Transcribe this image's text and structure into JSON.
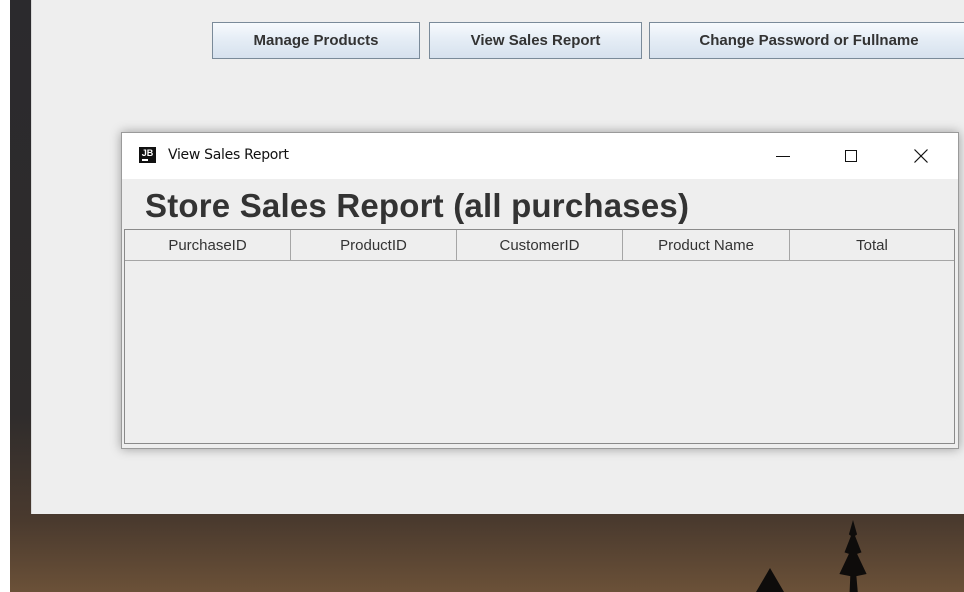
{
  "toolbar": {
    "manage_products_label": "Manage Products",
    "view_sales_report_label": "View Sales Report",
    "change_password_label": "Change Password or Fullname"
  },
  "dialog": {
    "title": "View Sales Report",
    "app_icon_text": "JB",
    "heading": "Store Sales Report (all purchases)",
    "controls": {
      "minimize_icon": "minimize-icon",
      "maximize_icon": "maximize-icon",
      "close_icon": "close-icon"
    },
    "table": {
      "columns": [
        "PurchaseID",
        "ProductID",
        "CustomerID",
        "Product Name",
        "Total"
      ],
      "rows": []
    }
  }
}
